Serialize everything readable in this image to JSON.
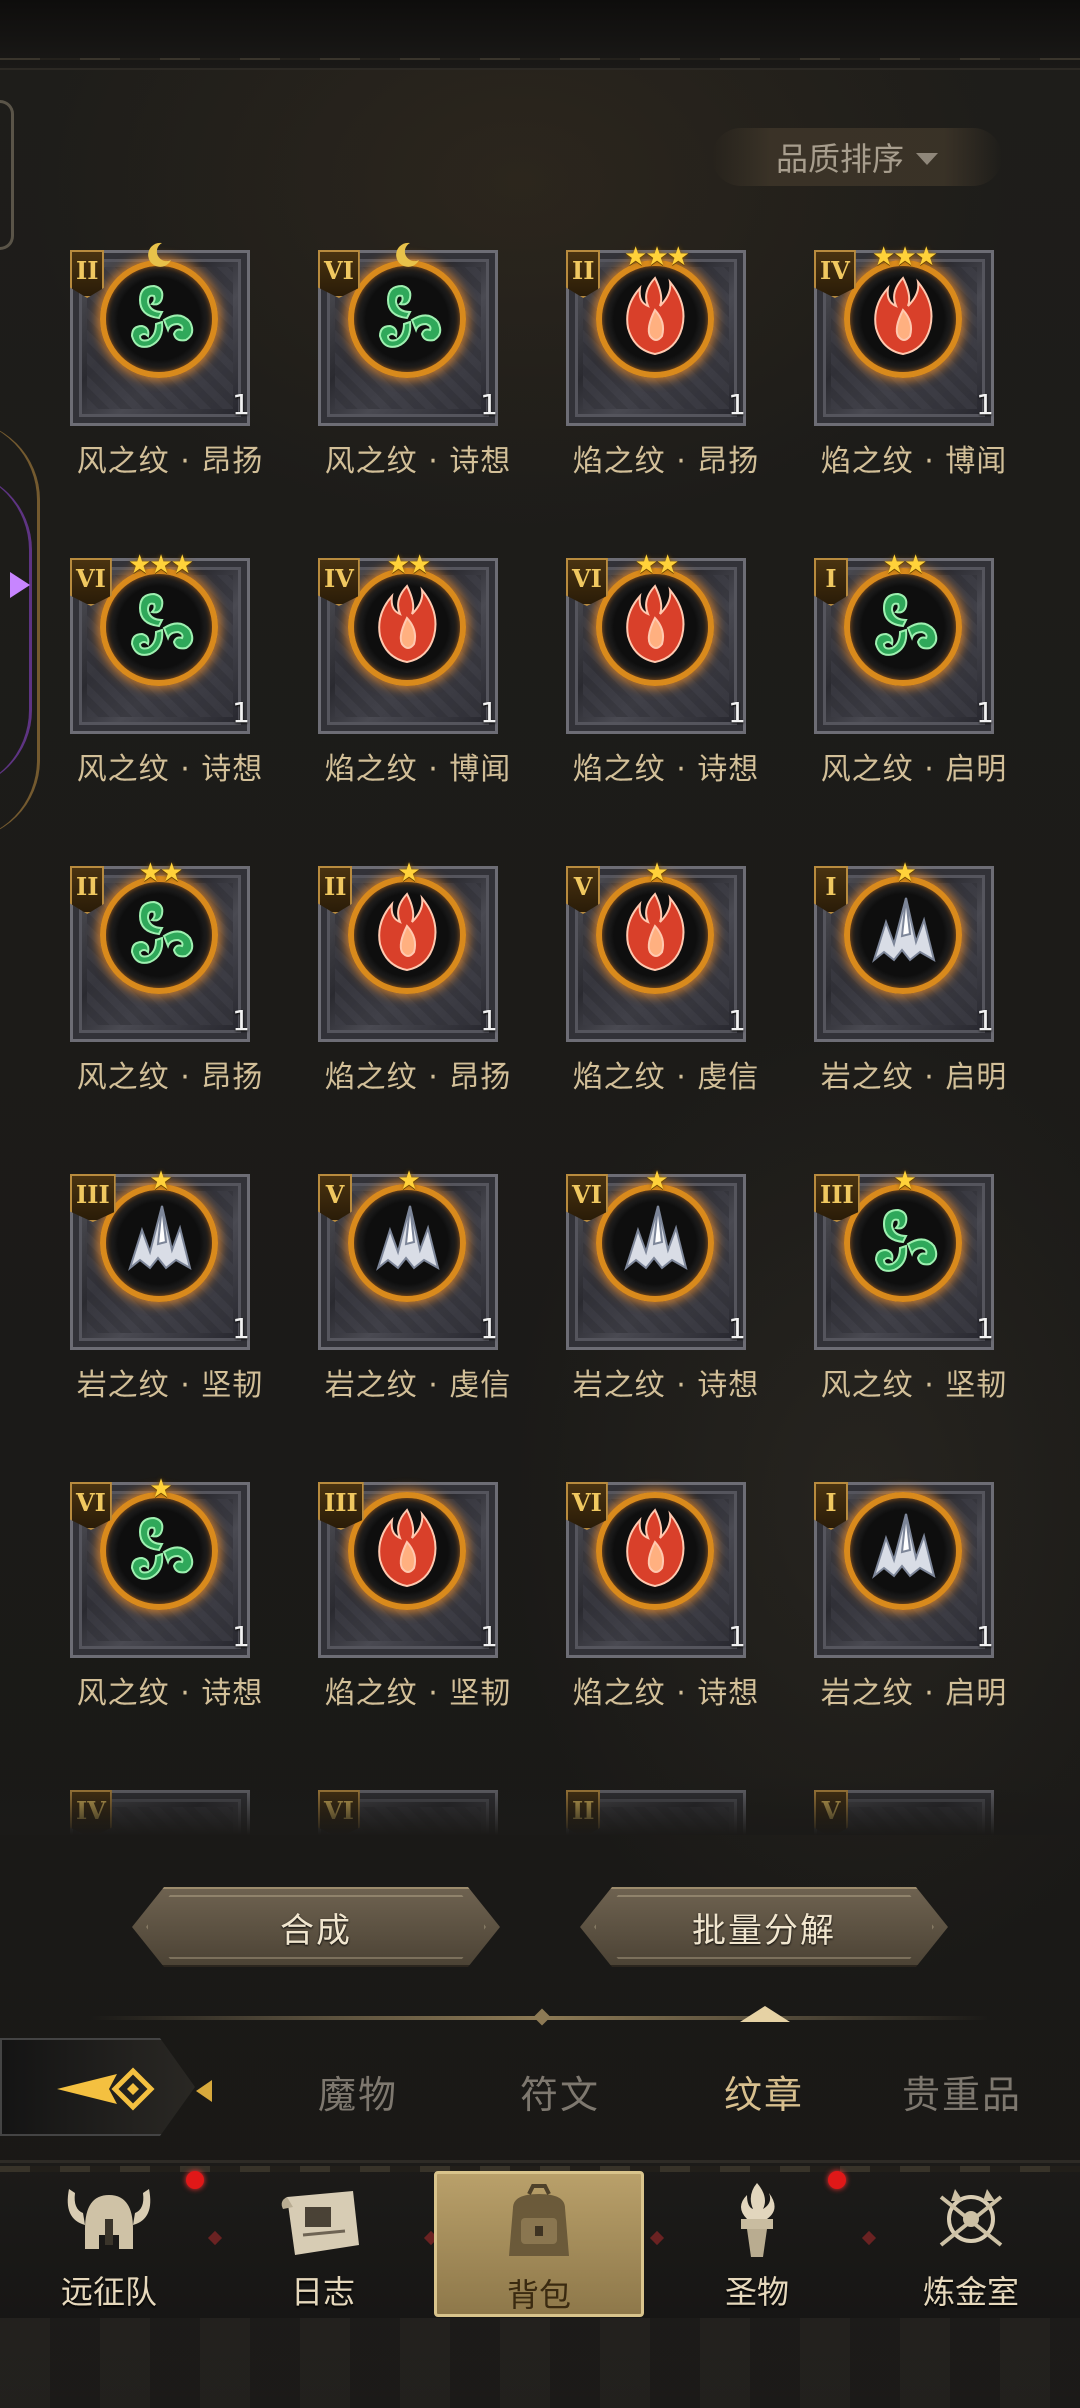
{
  "sort": {
    "label": "品质排序",
    "caret_icon": "chevron-down-icon"
  },
  "items": [
    {
      "name": "风之纹 · 昂扬",
      "element": "wind",
      "grade": "II",
      "stars": 0,
      "crescent": true,
      "count": "1"
    },
    {
      "name": "风之纹 · 诗想",
      "element": "wind",
      "grade": "VI",
      "stars": 0,
      "crescent": true,
      "count": "1"
    },
    {
      "name": "焰之纹 · 昂扬",
      "element": "fire",
      "grade": "II",
      "stars": 3,
      "crescent": false,
      "count": "1"
    },
    {
      "name": "焰之纹 · 博闻",
      "element": "fire",
      "grade": "IV",
      "stars": 3,
      "crescent": false,
      "count": "1"
    },
    {
      "name": "风之纹 · 诗想",
      "element": "wind",
      "grade": "VI",
      "stars": 3,
      "crescent": false,
      "count": "1"
    },
    {
      "name": "焰之纹 · 博闻",
      "element": "fire",
      "grade": "IV",
      "stars": 2,
      "crescent": false,
      "count": "1"
    },
    {
      "name": "焰之纹 · 诗想",
      "element": "fire",
      "grade": "VI",
      "stars": 2,
      "crescent": false,
      "count": "1"
    },
    {
      "name": "风之纹 · 启明",
      "element": "wind",
      "grade": "I",
      "stars": 2,
      "crescent": false,
      "count": "1"
    },
    {
      "name": "风之纹 · 昂扬",
      "element": "wind",
      "grade": "II",
      "stars": 2,
      "crescent": false,
      "count": "1"
    },
    {
      "name": "焰之纹 · 昂扬",
      "element": "fire",
      "grade": "II",
      "stars": 1,
      "crescent": false,
      "count": "1"
    },
    {
      "name": "焰之纹 · 虔信",
      "element": "fire",
      "grade": "V",
      "stars": 1,
      "crescent": false,
      "count": "1"
    },
    {
      "name": "岩之纹 · 启明",
      "element": "rock",
      "grade": "I",
      "stars": 1,
      "crescent": false,
      "count": "1"
    },
    {
      "name": "岩之纹 · 坚韧",
      "element": "rock",
      "grade": "III",
      "stars": 1,
      "crescent": false,
      "count": "1"
    },
    {
      "name": "岩之纹 · 虔信",
      "element": "rock",
      "grade": "V",
      "stars": 1,
      "crescent": false,
      "count": "1"
    },
    {
      "name": "岩之纹 · 诗想",
      "element": "rock",
      "grade": "VI",
      "stars": 1,
      "crescent": false,
      "count": "1"
    },
    {
      "name": "风之纹 · 坚韧",
      "element": "wind",
      "grade": "III",
      "stars": 1,
      "crescent": false,
      "count": "1"
    },
    {
      "name": "风之纹 · 诗想",
      "element": "wind",
      "grade": "VI",
      "stars": 1,
      "crescent": false,
      "count": "1"
    },
    {
      "name": "焰之纹 · 坚韧",
      "element": "fire",
      "grade": "III",
      "stars": 0,
      "crescent": false,
      "count": "1"
    },
    {
      "name": "焰之纹 · 诗想",
      "element": "fire",
      "grade": "VI",
      "stars": 0,
      "crescent": false,
      "count": "1"
    },
    {
      "name": "岩之纹 · 启明",
      "element": "rock",
      "grade": "I",
      "stars": 0,
      "crescent": false,
      "count": "1"
    },
    {
      "name": "",
      "element": "",
      "grade": "IV",
      "stars": 0,
      "crescent": false,
      "count": ""
    },
    {
      "name": "",
      "element": "",
      "grade": "VI",
      "stars": 0,
      "crescent": false,
      "count": ""
    },
    {
      "name": "",
      "element": "",
      "grade": "II",
      "stars": 0,
      "crescent": false,
      "count": ""
    },
    {
      "name": "",
      "element": "",
      "grade": "V",
      "stars": 0,
      "crescent": false,
      "count": ""
    }
  ],
  "actions": {
    "compose": "合成",
    "decompose": "批量分解"
  },
  "tabs": {
    "back_icon": "arrow-left-icon",
    "items": [
      {
        "label": "魔物",
        "active": false
      },
      {
        "label": "符文",
        "active": false
      },
      {
        "label": "纹章",
        "active": true
      },
      {
        "label": "贵重品",
        "active": false
      }
    ]
  },
  "nav": [
    {
      "label": "远征队",
      "icon": "viking-helmet-icon",
      "active": false,
      "badge": true
    },
    {
      "label": "日志",
      "icon": "scroll-icon",
      "active": false,
      "badge": false
    },
    {
      "label": "背包",
      "icon": "backpack-icon",
      "active": true,
      "badge": false
    },
    {
      "label": "圣物",
      "icon": "torch-icon",
      "active": false,
      "badge": true
    },
    {
      "label": "炼金室",
      "icon": "alchemy-icon",
      "active": false,
      "badge": false
    }
  ],
  "colors": {
    "star": "#ffd23a",
    "ring": "#d98a1c",
    "text": "#d2bf98",
    "badge": "#e01818",
    "active_nav": "#b9a06a"
  }
}
